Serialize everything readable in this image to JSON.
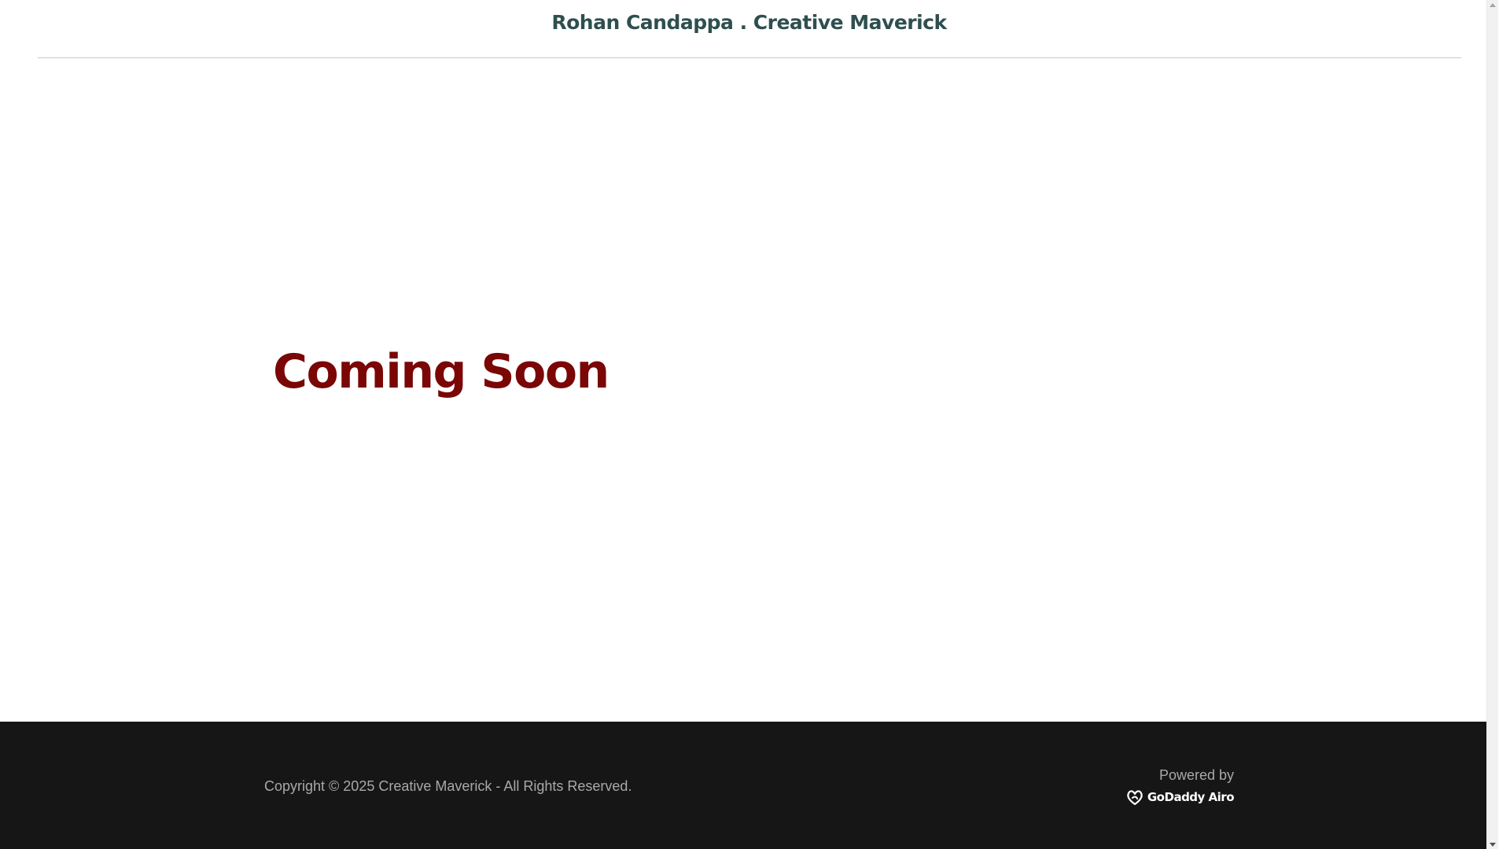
{
  "header": {
    "site_title": "Rohan Candappa . Creative Maverick"
  },
  "hero": {
    "title": "Coming Soon"
  },
  "footer": {
    "copyright": "Copyright © 2025 Creative Maverick - All Rights Reserved.",
    "powered_by_label": "Powered by",
    "brand_logo_text": "GoDaddy Airo",
    "brand_icon": "godaddy-logo-icon"
  },
  "colors": {
    "title_color": "#2f4f4f",
    "hero_color": "#7a0606",
    "footer_bg": "#161616",
    "footer_text": "#a9a9a9"
  }
}
